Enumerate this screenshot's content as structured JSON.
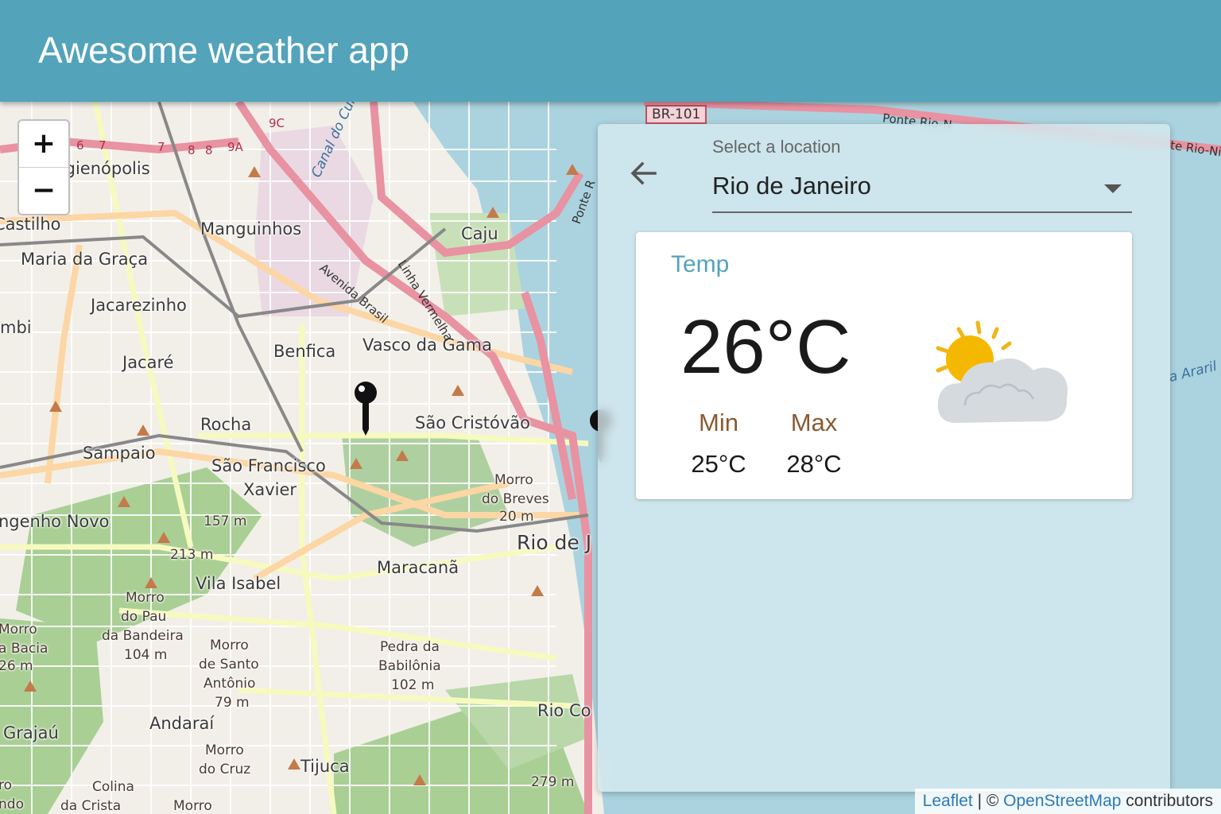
{
  "app": {
    "title": "Awesome weather app"
  },
  "map": {
    "zoom_in": "+",
    "zoom_out": "−",
    "labels": {
      "higienopolis": "Higienópolis",
      "castilho": "Castilho",
      "manguinhos": "Manguinhos",
      "maria_da_graca": "Maria da Graça",
      "jacarezinho": "Jacarezinho",
      "mbi": "mbi",
      "benfica": "Benfica",
      "vasco": "Vasco da Gama",
      "jacare": "Jacaré",
      "rocha": "Rocha",
      "sao_cristovao": "São Cristóvão",
      "sampaio": "Sampaio",
      "sao_francisco": "São Francisco",
      "xavier": "Xavier",
      "engenho_novo": "ngenho Novo",
      "morro_breves": "Morro",
      "breves_2": "do Breves",
      "breves_3": "20 m",
      "rio_de_j": "Rio de J",
      "m157": "157 m",
      "m213": "213 m",
      "maracana": "Maracanã",
      "vila_isabel": "Vila Isabel",
      "morro_pau_1": "Morro",
      "morro_pau_2": "do Pau",
      "morro_pau_3": "da Bandeira",
      "morro_pau_4": "104 m",
      "morro_bacia_1": "Morro",
      "morro_bacia_2": "a Bacia",
      "morro_bacia_3": "26 m",
      "santo_1": "Morro",
      "santo_2": "de Santo",
      "santo_3": "Antônio",
      "santo_4": "79 m",
      "pedra_1": "Pedra da",
      "pedra_2": "Babilônia",
      "pedra_3": "102 m",
      "grajau": "Grajaú",
      "andarai": "Andaraí",
      "cruz_1": "Morro",
      "cruz_2": "do Cruz",
      "tijuca": "Tijuca",
      "rio_com": "Rio Co",
      "colina_1": "Colina",
      "colina_2": "da Crista",
      "morro_bottom": "Morro",
      "ro": "ro",
      "ndo": "ndo",
      "caju": "Caju",
      "m279": "279 m",
      "canal": "Canal do Cunha",
      "av_brasil": "Avenida Brasil",
      "linha_vermelha": "Linha Vermelha",
      "ponte": "Ponte R",
      "br101": "BR-101",
      "ponte_rio_1": "Ponte Rio-N",
      "ponte_rio_2": "te Rio-Ni",
      "arari": "a Araril",
      "r_9c": "9C",
      "r_9a": "9A",
      "r_8a": "8",
      "r_8b": "8",
      "r_7a": "7",
      "r_7b": "7",
      "r_6": "6"
    },
    "attribution": {
      "leaflet": "Leaflet",
      "sep": " | © ",
      "osm": "OpenStreetMap",
      "contrib": " contributors"
    }
  },
  "panel": {
    "select_label": "Select a location",
    "selected_location": "Rio de Janeiro",
    "card": {
      "title": "Temp",
      "temperature": "26°C",
      "min_label": "Min",
      "max_label": "Max",
      "min_value": "25°C",
      "max_value": "28°C",
      "icon": "partly-cloudy-icon"
    }
  },
  "colors": {
    "appbar": "#53a3ba",
    "accent": "#53a3ba",
    "minmax": "#8a5a32"
  }
}
